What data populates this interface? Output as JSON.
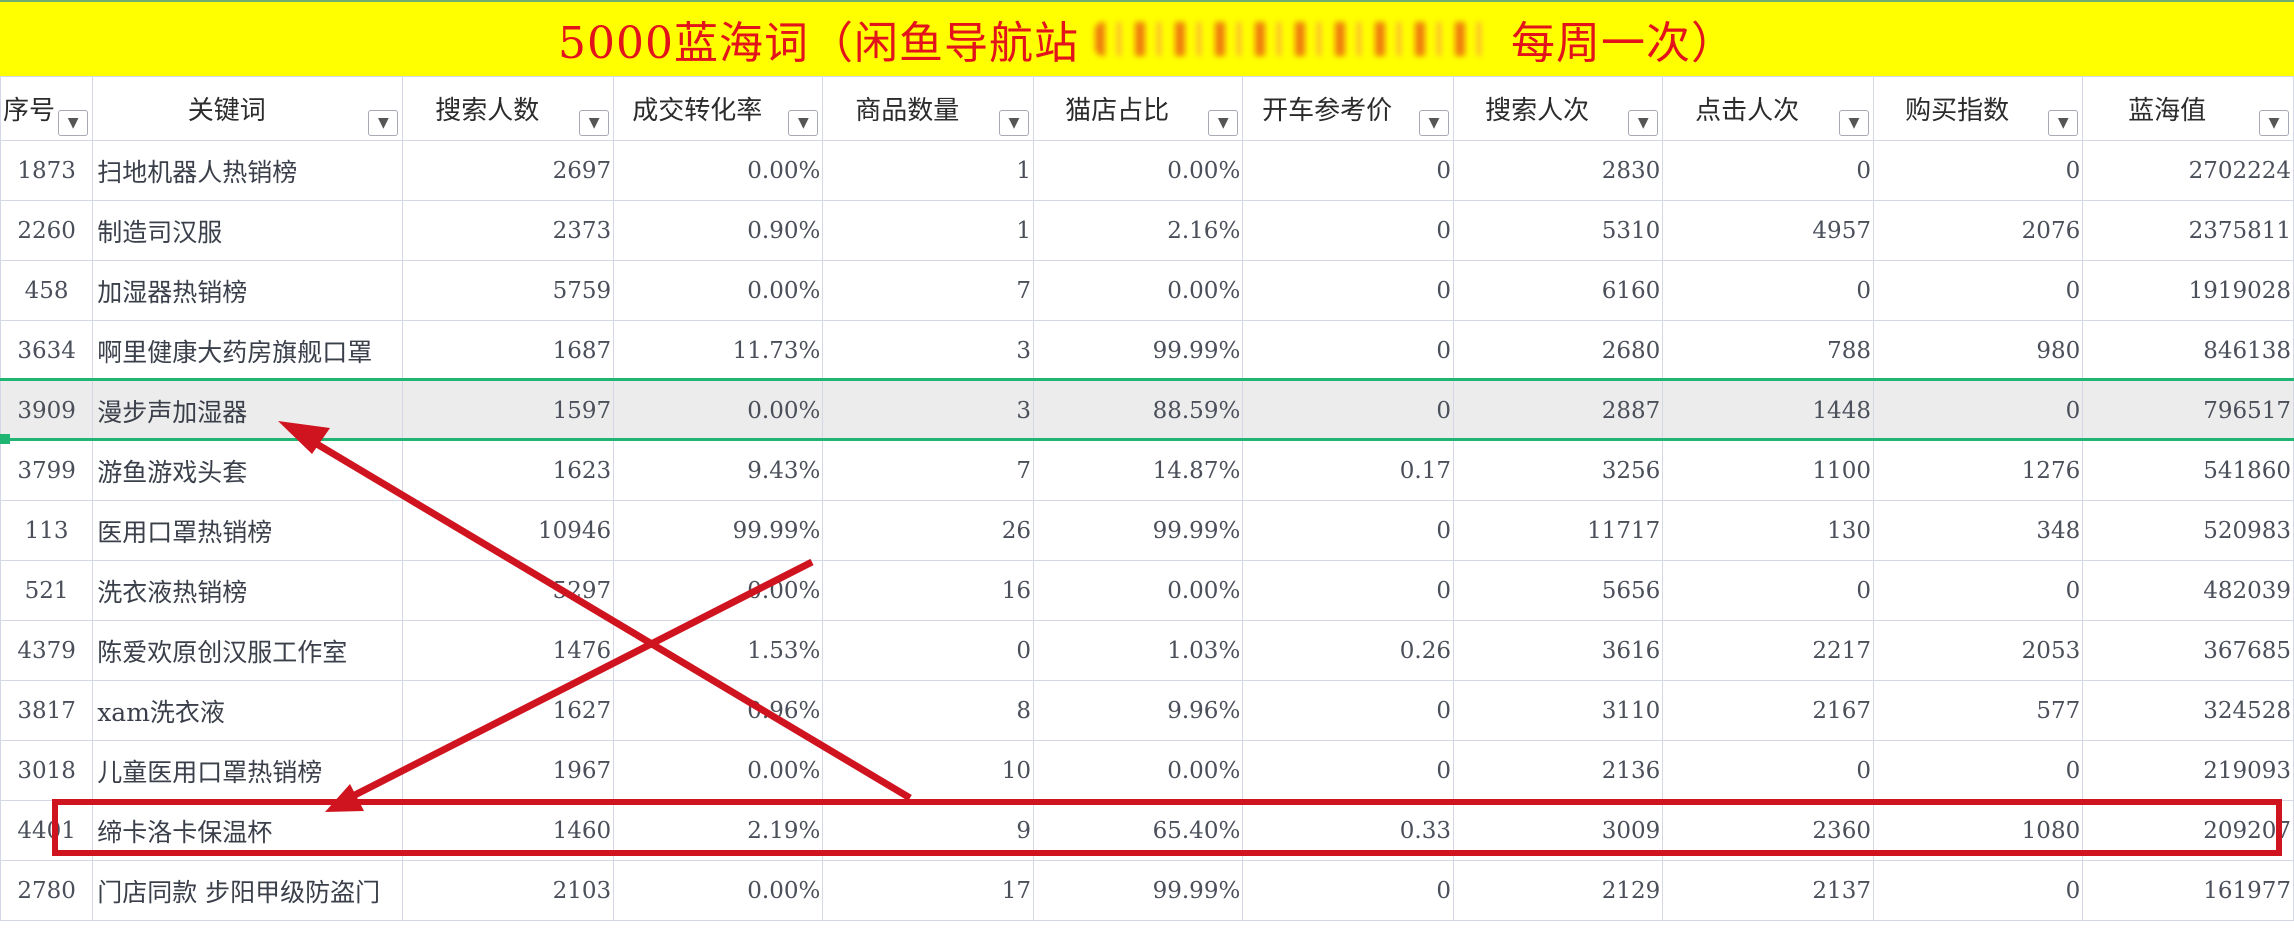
{
  "title": {
    "prefix": "5000蓝海词（闲鱼导航站",
    "suffix": "每周一次）"
  },
  "columns": [
    "序号",
    "关键词",
    "搜索人数",
    "成交转化率",
    "商品数量",
    "猫店占比",
    "开车参考价",
    "搜索人次",
    "点击人次",
    "购买指数",
    "蓝海值"
  ],
  "filter_icon": "dropdown-triangle-icon",
  "rows": [
    [
      "1873",
      "扫地机器人热销榜",
      "2697",
      "0.00%",
      "1",
      "0.00%",
      "0",
      "2830",
      "0",
      "0",
      "2702224"
    ],
    [
      "2260",
      "制造司汉服",
      "2373",
      "0.90%",
      "1",
      "2.16%",
      "0",
      "5310",
      "4957",
      "2076",
      "2375811"
    ],
    [
      "458",
      "加湿器热销榜",
      "5759",
      "0.00%",
      "7",
      "0.00%",
      "0",
      "6160",
      "0",
      "0",
      "1919028"
    ],
    [
      "3634",
      "啊里健康大药房旗舰口罩",
      "1687",
      "11.73%",
      "3",
      "99.99%",
      "0",
      "2680",
      "788",
      "980",
      "846138"
    ],
    [
      "3909",
      "漫步声加湿器",
      "1597",
      "0.00%",
      "3",
      "88.59%",
      "0",
      "2887",
      "1448",
      "0",
      "796517"
    ],
    [
      "3799",
      "游鱼游戏头套",
      "1623",
      "9.43%",
      "7",
      "14.87%",
      "0.17",
      "3256",
      "1100",
      "1276",
      "541860"
    ],
    [
      "113",
      "医用口罩热销榜",
      "10946",
      "99.99%",
      "26",
      "99.99%",
      "0",
      "11717",
      "130",
      "348",
      "520983"
    ],
    [
      "521",
      "洗衣液热销榜",
      "5297",
      "0.00%",
      "16",
      "0.00%",
      "0",
      "5656",
      "0",
      "0",
      "482039"
    ],
    [
      "4379",
      "陈爱欢原创汉服工作室",
      "1476",
      "1.53%",
      "0",
      "1.03%",
      "0.26",
      "3616",
      "2217",
      "2053",
      "367685"
    ],
    [
      "3817",
      "xam洗衣液",
      "1627",
      "0.96%",
      "8",
      "9.96%",
      "0",
      "3110",
      "2167",
      "577",
      "324528"
    ],
    [
      "3018",
      "儿童医用口罩热销榜",
      "1967",
      "0.00%",
      "10",
      "0.00%",
      "0",
      "2136",
      "0",
      "0",
      "219093"
    ],
    [
      "4401",
      "缔卡洛卡保温杯",
      "1460",
      "2.19%",
      "9",
      "65.40%",
      "0.33",
      "3009",
      "2360",
      "1080",
      "209207"
    ],
    [
      "2780",
      "门店同款 步阳甲级防盗门",
      "2103",
      "0.00%",
      "17",
      "99.99%",
      "0",
      "2129",
      "2137",
      "0",
      "161977"
    ]
  ],
  "selected_row_index": 4,
  "annotated_row_index": 11,
  "colors": {
    "title_bg": "#ffff00",
    "title_text": "#e2131a",
    "selection": "#21b573",
    "annotation": "#d0141f"
  }
}
